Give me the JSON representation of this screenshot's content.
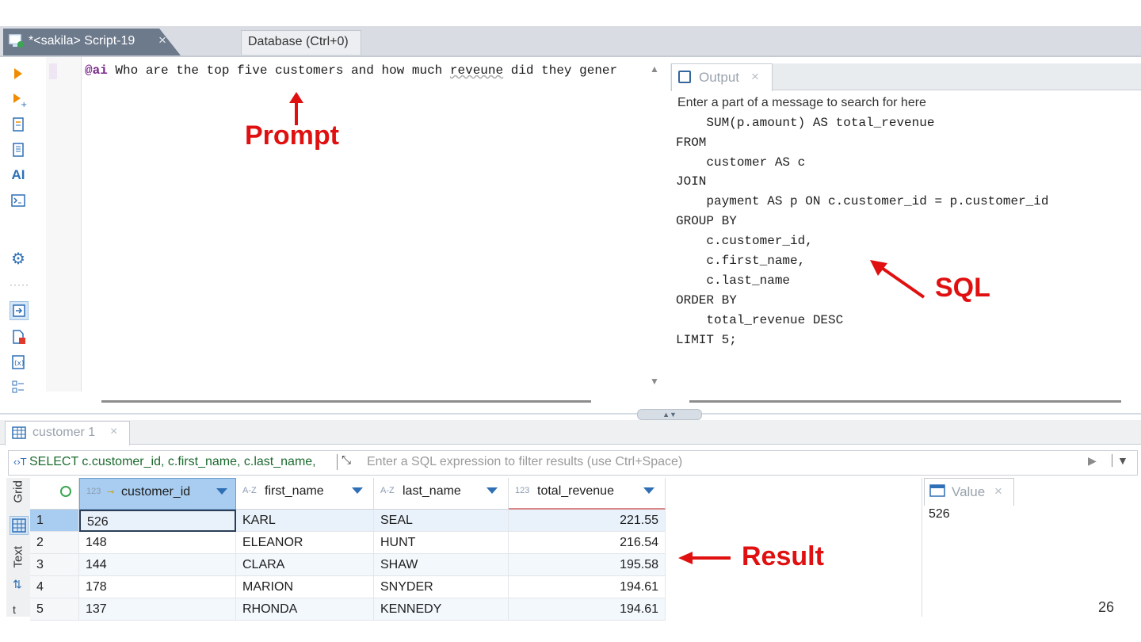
{
  "editor_tabs": [
    {
      "label": "*<sakila> Script-19",
      "active": true
    },
    {
      "label": "Database (Ctrl+0)",
      "active": false
    }
  ],
  "editor": {
    "prompt_prefix": "@ai",
    "prompt_text": " Who are the top five customers and how much ",
    "prompt_misspelled": "reveune",
    "prompt_rest": " did they gener"
  },
  "left_toolbar": [
    "run-statement-icon",
    "run-new-tab-icon",
    "execute-script-icon",
    "execute-script-new-tab-icon",
    "AI",
    "open-console-icon",
    "settings-icon",
    "show-output-icon",
    "show-errors-icon",
    "show-variables-icon",
    "outline-icon"
  ],
  "output_panel": {
    "tab_label": "Output",
    "search_placeholder": "Enter a part of a message to search for here",
    "sql_lines": [
      "    SUM(p.amount) AS total_revenue",
      "FROM",
      "    customer AS c",
      "JOIN",
      "    payment AS p ON c.customer_id = p.customer_id",
      "GROUP BY",
      "    c.customer_id,",
      "    c.first_name,",
      "    c.last_name",
      "ORDER BY",
      "    total_revenue DESC",
      "LIMIT 5;"
    ]
  },
  "results": {
    "tab_label": "customer 1",
    "query_text": "SELECT c.customer_id, c.first_name, c.last_name,",
    "filter_placeholder": "Enter a SQL expression to filter results (use Ctrl+Space)",
    "side_tabs": [
      "Grid",
      "Text"
    ],
    "columns": [
      {
        "type": "123",
        "name": "customer_id"
      },
      {
        "type": "A-Z",
        "name": "first_name"
      },
      {
        "type": "A-Z",
        "name": "last_name"
      },
      {
        "type": "123",
        "name": "total_revenue"
      }
    ],
    "rows": [
      {
        "n": "1",
        "customer_id": "526",
        "first_name": "KARL",
        "last_name": "SEAL",
        "total_revenue": "221.55"
      },
      {
        "n": "2",
        "customer_id": "148",
        "first_name": "ELEANOR",
        "last_name": "HUNT",
        "total_revenue": "216.54"
      },
      {
        "n": "3",
        "customer_id": "144",
        "first_name": "CLARA",
        "last_name": "SHAW",
        "total_revenue": "195.58"
      },
      {
        "n": "4",
        "customer_id": "178",
        "first_name": "MARION",
        "last_name": "SNYDER",
        "total_revenue": "194.61"
      },
      {
        "n": "5",
        "customer_id": "137",
        "first_name": "RHONDA",
        "last_name": "KENNEDY",
        "total_revenue": "194.61"
      }
    ]
  },
  "value_panel": {
    "tab_label": "Value",
    "value": "526"
  },
  "annotations": {
    "prompt": "Prompt",
    "sql": "SQL",
    "result": "Result"
  },
  "slide_number": "26",
  "colors": {
    "annotation": "#e01010",
    "selected_header": "#a8cdf0",
    "active_tab": "#6d7a8c"
  }
}
